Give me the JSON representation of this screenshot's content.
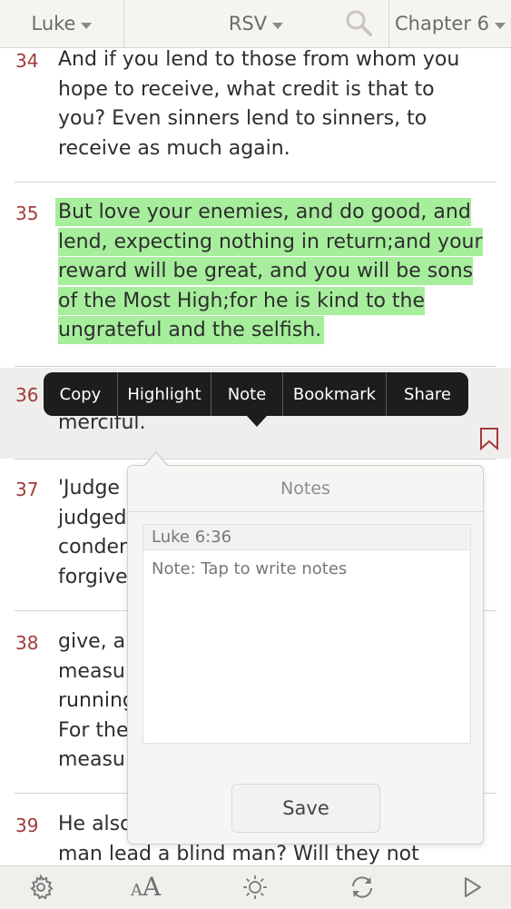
{
  "topbar": {
    "book": "Luke",
    "version": "RSV",
    "chapter": "Chapter 6"
  },
  "verses": [
    {
      "num": "34",
      "text": "And if you lend to those from whom you hope to receive, what credit is that to you? Even sinners lend to sinners, to receive as much again."
    },
    {
      "num": "35",
      "text": "But love your enemies, and do good, and lend, expecting nothing in return;and your reward will be great, and you will be sons of the Most High;for he is kind to the ungrateful and the selfish."
    },
    {
      "num": "36",
      "text": "merciful."
    },
    {
      "num": "37",
      "lines": [
        "'Judge",
        "judged",
        "conder",
        "forgive"
      ]
    },
    {
      "num": "38",
      "lines": [
        "give, ar",
        "measu",
        "running",
        "For the",
        "measu"
      ]
    },
    {
      "num": "39",
      "lines": [
        "He also",
        "man lead a blind man? Will they not"
      ]
    }
  ],
  "context_menu": {
    "items": [
      "Copy",
      "Highlight",
      "Note",
      "Bookmark",
      "Share"
    ]
  },
  "notes": {
    "title": "Notes",
    "reference": "Luke  6:36",
    "placeholder": "Note: Tap to write notes",
    "save_label": "Save"
  },
  "colors": {
    "verse_number": "#a43a3a",
    "highlight": "#a6ee9c",
    "menu_bg": "#1d1d1d"
  },
  "icons": [
    "search-icon",
    "bookmark-icon",
    "gear-icon",
    "font-size-icon",
    "brightness-icon",
    "sync-icon",
    "play-icon"
  ]
}
